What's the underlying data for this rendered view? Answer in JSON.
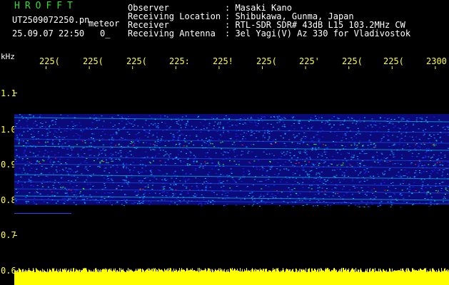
{
  "header": {
    "brand": "HROFFT",
    "filename": "UT2509072250.pn",
    "mode": "meteor",
    "datetime": "25.09.07 22:50",
    "counter": "0_",
    "fields": [
      {
        "label": "Observer",
        "value": ": Masaki Kano"
      },
      {
        "label": "Receiving Location",
        "value": ": Shibukawa, Gunma, Japan"
      },
      {
        "label": "Receiver",
        "value": ": RTL-SDR SDR# 43dB L15 103.2MHz CW"
      },
      {
        "label": "Receiving Antenna",
        "value": ": 3el Yagi(V) Az 330 for Vladivostok"
      }
    ]
  },
  "axis": {
    "y_unit": "kHz",
    "y_ticks": [
      "1.1",
      "1.0",
      "0.9",
      "0.8",
      "0.7",
      "0.6"
    ],
    "x_ticks": [
      "225(",
      "225(",
      "225(",
      "225:",
      "225!",
      "225(",
      "225'",
      "225(",
      "225(",
      "2300"
    ]
  },
  "colors": {
    "background": "#000000",
    "label_text": "#ffffff",
    "value_text": "#ffff33",
    "brand_text": "#33dd33",
    "noise_floor": "#ffff00",
    "spectrogram_low": "#00008b",
    "spectrogram_mid": "#1e90ff",
    "spectrogram_high": "#00ff00",
    "spectrogram_peak": "#ff2020"
  },
  "spectrogram": {
    "description_bands_khz": [
      0.79,
      1.04
    ],
    "strong_lines_khz": [
      0.83,
      0.91,
      0.96
    ]
  }
}
